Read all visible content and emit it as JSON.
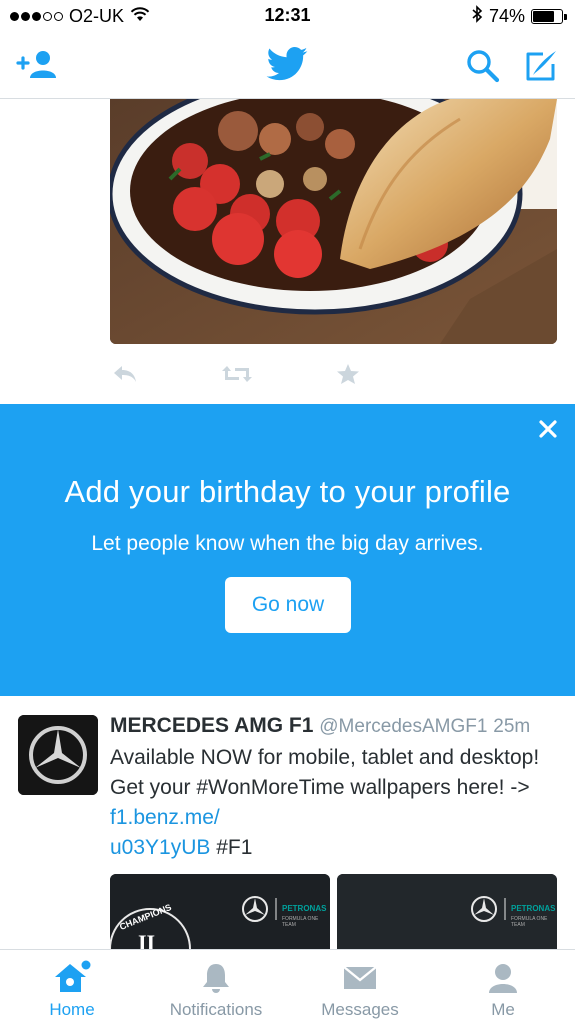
{
  "status_bar": {
    "carrier": "O2-UK",
    "time": "12:31",
    "battery": "74%",
    "battery_level": 0.74
  },
  "nav": {
    "add_user_icon": "add-user-icon",
    "logo_icon": "twitter-bird-icon",
    "search_icon": "search-icon",
    "compose_icon": "compose-icon"
  },
  "tweet_1": {
    "media": "photo-food-bowl",
    "actions": [
      "reply-icon",
      "retweet-icon",
      "favorite-icon"
    ]
  },
  "banner": {
    "title": "Add your birthday to your profile",
    "subtitle": "Let people know when the big day arrives.",
    "button": "Go now"
  },
  "tweet_2": {
    "name": "MERCEDES AMG F1",
    "handle": "@MercedesAMGF1",
    "time": "25m",
    "text_1": "Available NOW for mobile, tablet and desktop! Get your #WonMoreTime wallpapers here! -> ",
    "link_1": "f1.benz.me/",
    "link_2": "u03Y1yUB",
    "text_2": " #F1",
    "media_left_badge": "CHAMPIONS",
    "media_left_badge_numeral": "II",
    "media_brand_line": "PETRONAS",
    "media_brand_sub": "FORMULA ONE TEAM"
  },
  "tabs": [
    {
      "label": "Home",
      "icon": "home-icon",
      "active": true
    },
    {
      "label": "Notifications",
      "icon": "bell-icon",
      "active": false
    },
    {
      "label": "Messages",
      "icon": "envelope-icon",
      "active": false
    },
    {
      "label": "Me",
      "icon": "person-icon",
      "active": false
    }
  ],
  "colors": {
    "brand": "#1da1f2",
    "text": "#292f33",
    "muted": "#8899a6",
    "link": "#1b95e0"
  }
}
